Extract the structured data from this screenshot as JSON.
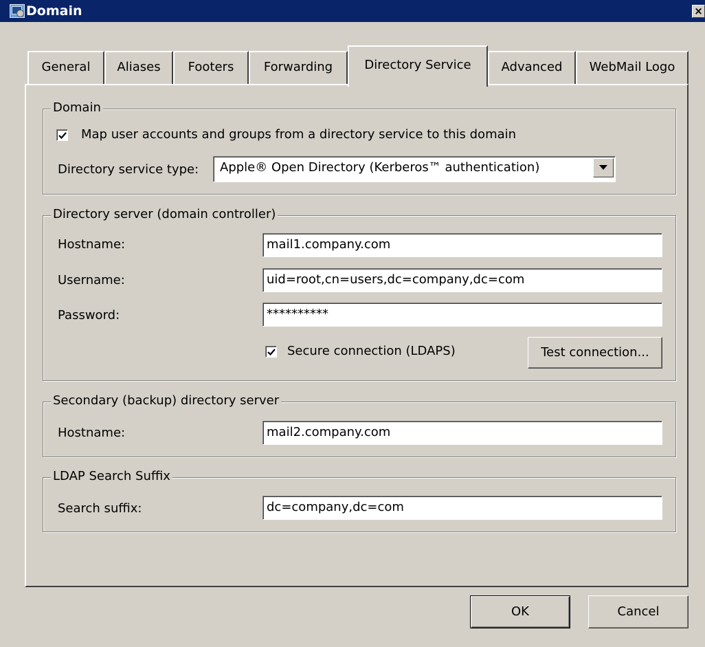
{
  "window": {
    "title": "Domain",
    "close_glyph": "×"
  },
  "tabs": [
    {
      "label": "General",
      "active": false
    },
    {
      "label": "Aliases",
      "active": false
    },
    {
      "label": "Footers",
      "active": false
    },
    {
      "label": "Forwarding",
      "active": false
    },
    {
      "label": "Directory Service",
      "active": true
    },
    {
      "label": "Advanced",
      "active": false
    },
    {
      "label": "WebMail Logo",
      "active": false
    }
  ],
  "domain_group": {
    "legend": "Domain",
    "map_checkbox": {
      "label": "Map user accounts and groups from a directory service to this domain",
      "checked": true
    },
    "type_label": "Directory service type:",
    "type_value": "Apple® Open Directory (Kerberos™ authentication)"
  },
  "server_group": {
    "legend": "Directory server (domain controller)",
    "hostname_label": "Hostname:",
    "hostname_value": "mail1.company.com",
    "username_label": "Username:",
    "username_value": "uid=root,cn=users,dc=company,dc=com",
    "password_label": "Password:",
    "password_value": "**********",
    "secure_checkbox": {
      "label": "Secure connection (LDAPS)",
      "checked": true
    },
    "test_button": "Test connection..."
  },
  "secondary_group": {
    "legend": "Secondary (backup) directory server",
    "hostname_label": "Hostname:",
    "hostname_value": "mail2.company.com"
  },
  "ldap_group": {
    "legend": "LDAP Search Suffix",
    "suffix_label": "Search suffix:",
    "suffix_value": "dc=company,dc=com"
  },
  "footer": {
    "ok": "OK",
    "cancel": "Cancel"
  },
  "colors": {
    "titlebar": "#0a246a",
    "face": "#d4d0c8"
  }
}
